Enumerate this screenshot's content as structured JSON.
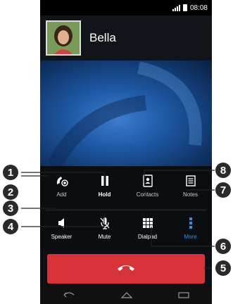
{
  "status_bar": {
    "time": "08:08"
  },
  "caller": {
    "name": "Bella"
  },
  "controls": {
    "add": "Add",
    "hold": "Hold",
    "contacts": "Contacts",
    "notes": "Notes",
    "speaker": "Speaker",
    "mute": "Mute",
    "dialpad": "Dialpad",
    "more": "More"
  },
  "callouts": [
    "1",
    "2",
    "3",
    "4",
    "5",
    "6",
    "7",
    "8"
  ],
  "colors": {
    "end_call": "#d73339",
    "more_accent": "#2f8fe6"
  }
}
